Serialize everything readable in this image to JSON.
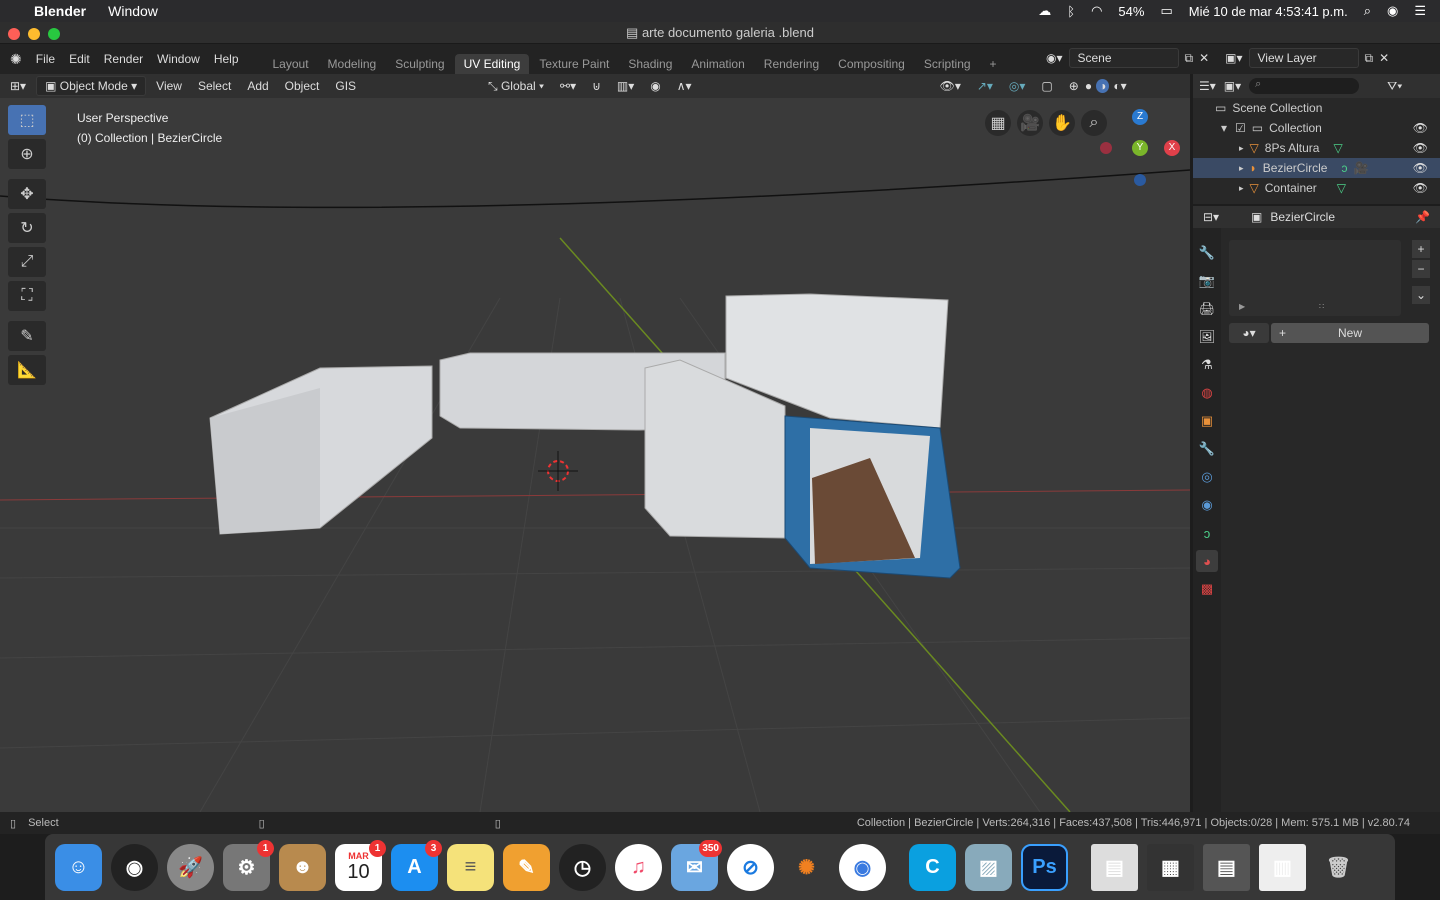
{
  "macos": {
    "app_name": "Blender",
    "menu": [
      "Window"
    ],
    "battery": "54%",
    "clock": "Mié 10 de mar  4:53:41 p.m."
  },
  "window": {
    "title": "arte documento galeria .blend"
  },
  "topbar": {
    "menus": [
      "File",
      "Edit",
      "Render",
      "Window",
      "Help"
    ],
    "workspaces": [
      "Layout",
      "Modeling",
      "Sculpting",
      "UV Editing",
      "Texture Paint",
      "Shading",
      "Animation",
      "Rendering",
      "Compositing",
      "Scripting"
    ],
    "active_workspace": "UV Editing",
    "scene": "Scene",
    "view_layer": "View Layer"
  },
  "viewport_header": {
    "mode": "Object Mode",
    "menus": [
      "View",
      "Select",
      "Add",
      "Object",
      "GIS"
    ],
    "orientation": "Global"
  },
  "viewport": {
    "perspective": "User Perspective",
    "collection_line": "(0) Collection | BezierCircle"
  },
  "outliner": {
    "root": "Scene Collection",
    "collection": "Collection",
    "items": [
      "8Ps Altura",
      "BezierCircle",
      "Container"
    ],
    "selected": "BezierCircle"
  },
  "properties": {
    "object_name": "BezierCircle",
    "new_button": "New"
  },
  "status": {
    "left": "Select",
    "right": "Collection | BezierCircle | Verts:264,316 | Faces:437,508 | Tris:446,971 | Objects:0/28 | Mem: 575.1 MB | v2.80.74"
  },
  "dock": {
    "calendar_month": "MAR",
    "calendar_day": "10",
    "badges": {
      "settings": "1",
      "calendar": "1",
      "appstore": "3",
      "mail": "350"
    },
    "ps_label": "Ps"
  },
  "colors": {
    "accent": "#4772b3",
    "selected_row": "#3a4a64"
  }
}
